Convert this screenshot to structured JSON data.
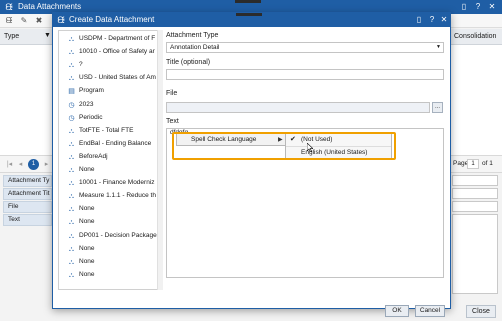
{
  "outer": {
    "title": "Data Attachments",
    "grid_headers": {
      "type": "Type",
      "consolidation": "Consolidation"
    },
    "pager": {
      "current_page": "1",
      "page_label": "Page",
      "page_value": "1",
      "of_label": "of 1"
    },
    "detail_labels": [
      "Attachment Ty",
      "Attachment Tit",
      "File",
      "Text"
    ],
    "close_label": "Close"
  },
  "dialog": {
    "title": "Create Data Attachment",
    "tree": [
      {
        "icon": "member-icon",
        "label": "USDPM - Department of F"
      },
      {
        "icon": "member-icon",
        "label": "10010 - Office of Safety ar"
      },
      {
        "icon": "member-icon",
        "label": "?"
      },
      {
        "icon": "member-icon",
        "label": "USD - United States of Am"
      },
      {
        "icon": "folder-icon",
        "label": "Program"
      },
      {
        "icon": "clock-icon",
        "label": "2023"
      },
      {
        "icon": "clock-icon",
        "label": "Periodic"
      },
      {
        "icon": "member-icon",
        "label": "TotFTE - Total FTE"
      },
      {
        "icon": "member-icon",
        "label": "EndBal - Ending Balance"
      },
      {
        "icon": "member-icon",
        "label": "BeforeAdj"
      },
      {
        "icon": "member-icon",
        "label": "None"
      },
      {
        "icon": "member-icon",
        "label": "10001 - Finance Moderniz"
      },
      {
        "icon": "member-icon",
        "label": "Measure 1.1.1 - Reduce th"
      },
      {
        "icon": "member-icon",
        "label": "None"
      },
      {
        "icon": "member-icon",
        "label": "None"
      },
      {
        "icon": "member-icon",
        "label": "DP001 - Decision Package"
      },
      {
        "icon": "member-icon",
        "label": "None"
      },
      {
        "icon": "member-icon",
        "label": "None"
      },
      {
        "icon": "member-icon",
        "label": "None"
      }
    ],
    "form": {
      "attachment_type_label": "Attachment Type",
      "attachment_type_value": "Annotation Detail",
      "title_label": "Title (optional)",
      "title_value": "",
      "file_label": "File",
      "file_value": "",
      "file_button": "...",
      "text_label": "Text",
      "text_value": "dfdgfg"
    },
    "context_menu": {
      "item": "Spell Check Language",
      "submenu": [
        {
          "label": "(Not Used)",
          "checked": true
        },
        {
          "label": "English (United States)",
          "checked": false
        }
      ]
    },
    "ok_label": "OK",
    "cancel_label": "Cancel"
  },
  "colors": {
    "accent": "#1f5ea5",
    "highlight": "#f0a000"
  }
}
